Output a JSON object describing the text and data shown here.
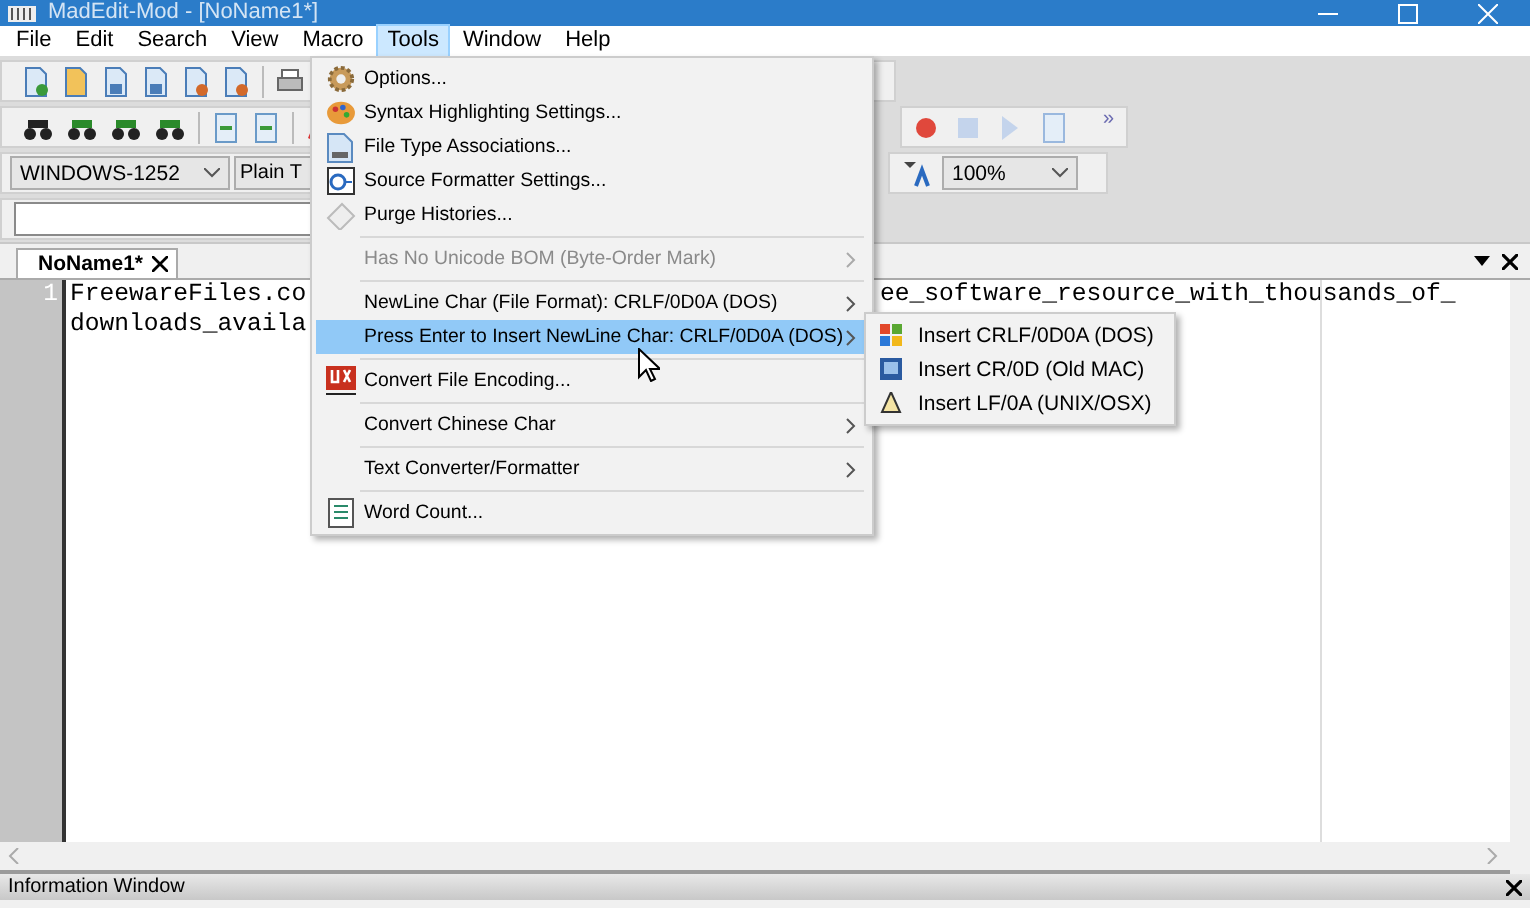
{
  "window": {
    "title": "MadEdit-Mod - [NoName1*]"
  },
  "menu_bar": [
    {
      "label": "File",
      "selected": false
    },
    {
      "label": "Edit",
      "selected": false
    },
    {
      "label": "Search",
      "selected": false
    },
    {
      "label": "View",
      "selected": false
    },
    {
      "label": "Macro",
      "selected": false
    },
    {
      "label": "Tools",
      "selected": true
    },
    {
      "label": "Window",
      "selected": false
    },
    {
      "label": "Help",
      "selected": false
    }
  ],
  "toolbar": {
    "encoding": "WINDOWS-1252",
    "syntax": "Plain T",
    "zoom": "100%",
    "overflow": "»"
  },
  "tab": {
    "label": "NoName1*"
  },
  "editor": {
    "line_number": "1",
    "lines": [
      {
        "left": "FreewareFiles.co",
        "right": "ee_software_resource_with_thousands_of_"
      },
      {
        "left": "downloads_availa"
      }
    ]
  },
  "tools_menu": [
    {
      "kind": "item",
      "label": "Options...",
      "disabled": false,
      "submenu": false,
      "selected": false
    },
    {
      "kind": "item",
      "label": "Syntax Highlighting Settings...",
      "disabled": false,
      "submenu": false,
      "selected": false
    },
    {
      "kind": "item",
      "label": "File Type Associations...",
      "disabled": false,
      "submenu": false,
      "selected": false
    },
    {
      "kind": "item",
      "label": "Source Formatter Settings...",
      "disabled": false,
      "submenu": false,
      "selected": false
    },
    {
      "kind": "item",
      "label": "Purge Histories...",
      "disabled": false,
      "submenu": false,
      "selected": false
    },
    {
      "kind": "separator"
    },
    {
      "kind": "item",
      "label": "Has No Unicode BOM (Byte-Order Mark)",
      "disabled": true,
      "submenu": true,
      "selected": false
    },
    {
      "kind": "separator"
    },
    {
      "kind": "item",
      "label": "NewLine Char (File Format): CRLF/0D0A (DOS)",
      "disabled": false,
      "submenu": true,
      "selected": false
    },
    {
      "kind": "item",
      "label": "Press Enter to Insert NewLine Char: CRLF/0D0A (DOS)",
      "disabled": false,
      "submenu": true,
      "selected": true
    },
    {
      "kind": "separator"
    },
    {
      "kind": "item",
      "label": "Convert File Encoding...",
      "disabled": false,
      "submenu": false,
      "selected": false
    },
    {
      "kind": "separator"
    },
    {
      "kind": "item",
      "label": "Convert Chinese Char",
      "disabled": false,
      "submenu": true,
      "selected": false
    },
    {
      "kind": "separator"
    },
    {
      "kind": "item",
      "label": "Text Converter/Formatter",
      "disabled": false,
      "submenu": true,
      "selected": false
    },
    {
      "kind": "separator"
    },
    {
      "kind": "item",
      "label": "Word Count...",
      "disabled": false,
      "submenu": false,
      "selected": false
    }
  ],
  "newline_submenu": [
    {
      "label": "Insert CRLF/0D0A (DOS)"
    },
    {
      "label": "Insert CR/0D (Old MAC)"
    },
    {
      "label": "Insert LF/0A (UNIX/OSX)"
    }
  ],
  "info_window": {
    "title": "Information Window"
  }
}
